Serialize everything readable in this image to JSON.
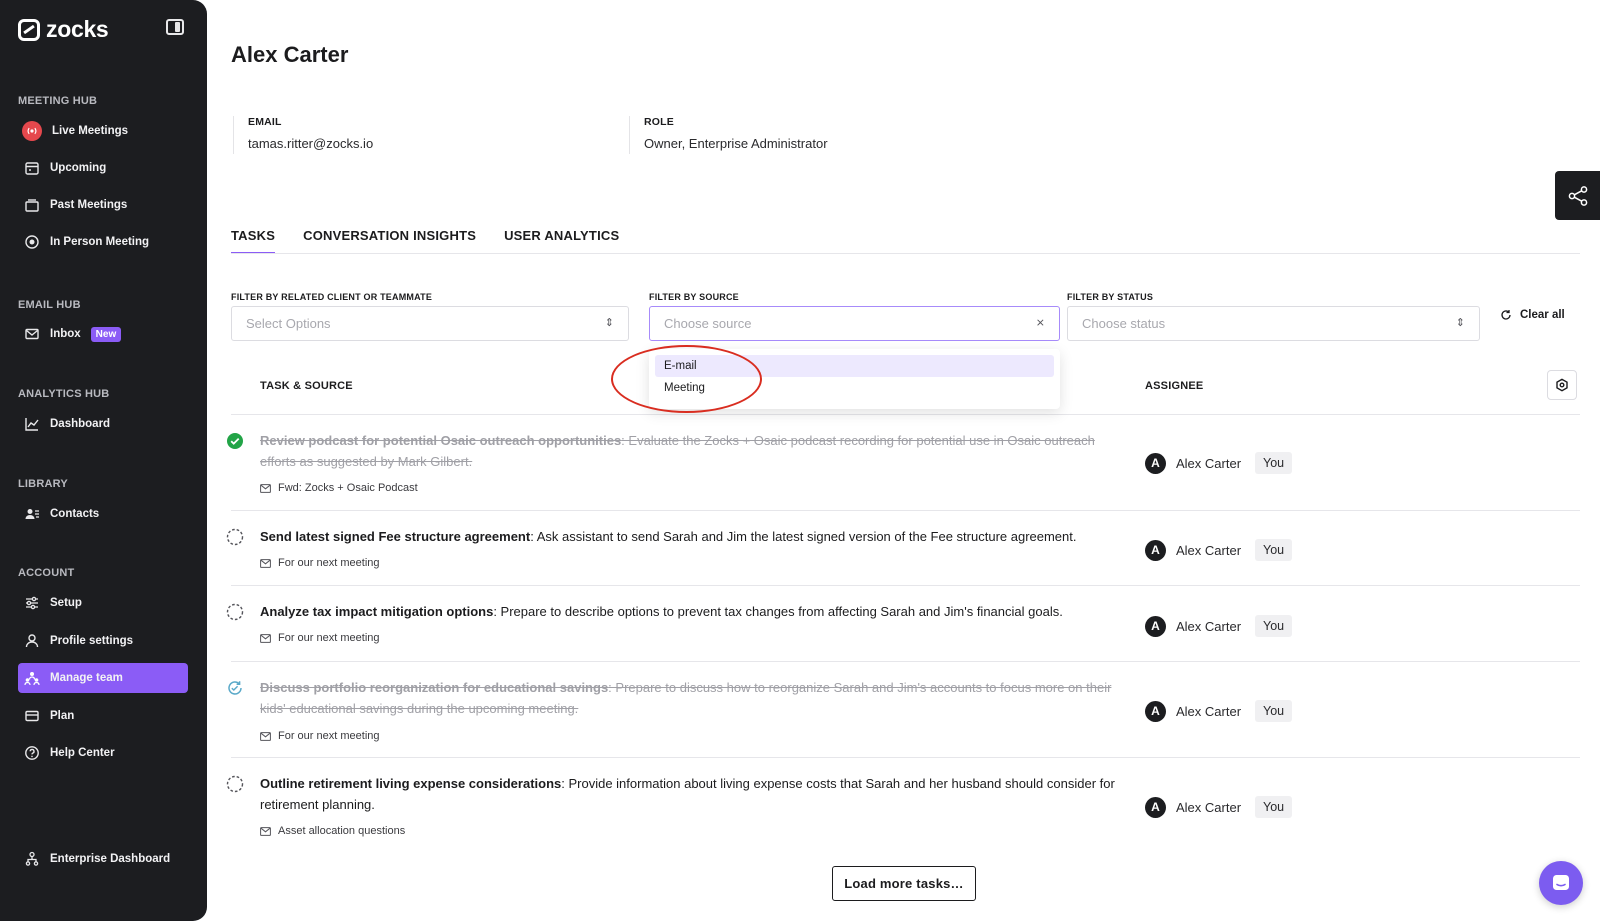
{
  "brand": {
    "name": "zocks"
  },
  "sidebar": {
    "sections": [
      {
        "label": "MEETING HUB"
      },
      {
        "label": "EMAIL HUB"
      },
      {
        "label": "ANALYTICS HUB"
      },
      {
        "label": "LIBRARY"
      },
      {
        "label": "ACCOUNT"
      }
    ],
    "items": [
      {
        "label": "Live Meetings",
        "icon": "broadcast-icon"
      },
      {
        "label": "Upcoming",
        "icon": "calendar-icon"
      },
      {
        "label": "Past Meetings",
        "icon": "archive-icon"
      },
      {
        "label": "In Person Meeting",
        "icon": "record-icon"
      },
      {
        "label": "Inbox",
        "icon": "mail-icon",
        "badge": "New"
      },
      {
        "label": "Dashboard",
        "icon": "line-chart-icon"
      },
      {
        "label": "Contacts",
        "icon": "contacts-icon"
      },
      {
        "label": "Setup",
        "icon": "sliders-icon"
      },
      {
        "label": "Profile settings",
        "icon": "user-icon"
      },
      {
        "label": "Manage team",
        "icon": "team-icon",
        "active": true
      },
      {
        "label": "Plan",
        "icon": "card-icon"
      },
      {
        "label": "Help Center",
        "icon": "help-icon"
      },
      {
        "label": "Enterprise Dashboard",
        "icon": "org-icon"
      }
    ]
  },
  "profile": {
    "name": "Alex Carter",
    "email_label": "EMAIL",
    "email": "tamas.ritter@zocks.io",
    "role_label": "ROLE",
    "role": "Owner, Enterprise Administrator"
  },
  "tabs": [
    "TASKS",
    "CONVERSATION INSIGHTS",
    "USER ANALYTICS"
  ],
  "filters": {
    "client": {
      "label": "FILTER BY RELATED CLIENT OR TEAMMATE",
      "placeholder": "Select Options"
    },
    "source": {
      "label": "FILTER BY SOURCE",
      "placeholder": "Choose source",
      "options": [
        "E-mail",
        "Meeting"
      ]
    },
    "status": {
      "label": "FILTER BY STATUS",
      "placeholder": "Choose status"
    },
    "clear_all": "Clear all"
  },
  "table": {
    "col_task": "TASK & SOURCE",
    "col_assignee": "ASSIGNEE",
    "rows": [
      {
        "status": "done",
        "title": "Review podcast for potential Osaic outreach opportunities",
        "desc": ": Evaluate the Zocks + Osaic podcast recording for potential use in Osaic outreach efforts as suggested by Mark Gilbert.",
        "source": "Fwd: Zocks + Osaic Podcast",
        "assignee": "Alex Carter",
        "avatar": "A",
        "you": "You"
      },
      {
        "status": "todo",
        "title": "Send latest signed Fee structure agreement",
        "desc": ": Ask assistant to send Sarah and Jim the latest signed version of the Fee structure agreement.",
        "source": "For our next meeting",
        "assignee": "Alex Carter",
        "avatar": "A",
        "you": "You"
      },
      {
        "status": "todo",
        "title": "Analyze tax impact mitigation options",
        "desc": ": Prepare to describe options to prevent tax changes from affecting Sarah and Jim's financial goals.",
        "source": "For our next meeting",
        "assignee": "Alex Carter",
        "avatar": "A",
        "you": "You"
      },
      {
        "status": "in-progress",
        "title": "Discuss portfolio reorganization for educational savings",
        "desc": ": Prepare to discuss how to reorganize Sarah and Jim's accounts to focus more on their kids' educational savings during the upcoming meeting.",
        "source": "For our next meeting",
        "assignee": "Alex Carter",
        "avatar": "A",
        "you": "You"
      },
      {
        "status": "todo",
        "title": "Outline retirement living expense considerations",
        "desc": ": Provide information about living expense costs that Sarah and her husband should consider for retirement planning.",
        "source": "Asset allocation questions",
        "assignee": "Alex Carter",
        "avatar": "A",
        "you": "You"
      }
    ]
  },
  "load_more": "Load more tasks…",
  "colors": {
    "accent": "#8b5cf6",
    "sidebar_bg": "#1c1d20",
    "done_green": "#22a447",
    "annotation_red": "#d92d20"
  }
}
